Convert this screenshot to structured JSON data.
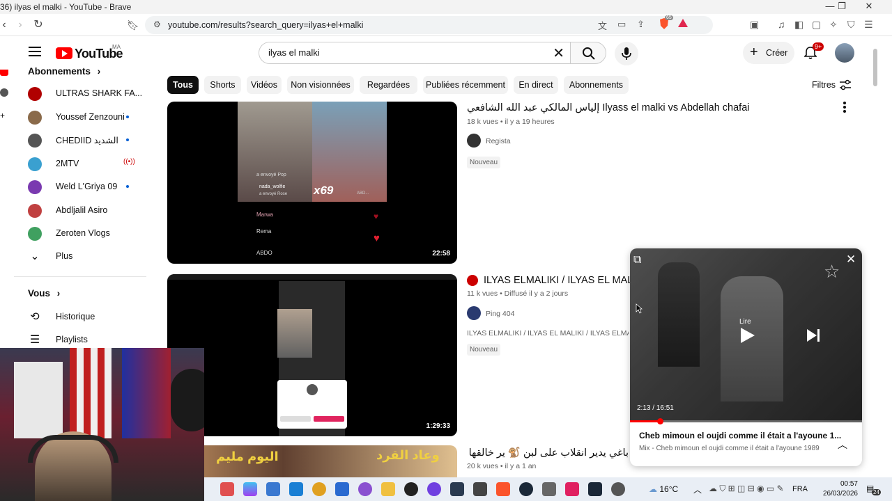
{
  "browser": {
    "window_title": "36) ilyas el malki - YouTube - Brave",
    "url": "youtube.com/results?search_query=ilyas+el+malki",
    "brave_badge": "65"
  },
  "header": {
    "logo_text": "YouTube",
    "country_code": "MA",
    "search_query": "ilyas el malki",
    "create_label": "Créer",
    "notif_badge": "9+"
  },
  "sidebar": {
    "subs_heading": "Abonnements",
    "subs_chevron": "›",
    "subscriptions": [
      {
        "name": "ULTRAS SHARK FA...",
        "color": "#b00000",
        "indicator": ""
      },
      {
        "name": "Youssef Zenzouni",
        "color": "#8a6a4a",
        "indicator": "dot"
      },
      {
        "name": "CHEDIID الشديد",
        "color": "#555555",
        "indicator": "dot"
      },
      {
        "name": "2MTV",
        "color": "#3aa0d0",
        "indicator": "live"
      },
      {
        "name": "Weld L'Griya 09",
        "color": "#7a3ab0",
        "indicator": "dot"
      },
      {
        "name": "Abdljalil Asiro",
        "color": "#c04040",
        "indicator": ""
      },
      {
        "name": "Zeroten Vlogs",
        "color": "#40a060",
        "indicator": ""
      }
    ],
    "more_label": "Plus",
    "you_heading": "Vous",
    "you_items": [
      {
        "label": "Historique"
      },
      {
        "label": "Playlists"
      }
    ]
  },
  "chips": [
    "Tous",
    "Shorts",
    "Vidéos",
    "Non visionnées",
    "Regardées",
    "Publiées récemment",
    "En direct",
    "Abonnements"
  ],
  "filters_label": "Filtres",
  "results": [
    {
      "title": "إلياس المالكي عبد الله الشافعي Ilyass el malki vs Abdellah chafai",
      "meta": "18 k vues • il y a 19 heures",
      "channel": "Regista",
      "badge": "Nouveau",
      "duration": "22:58",
      "thumb_texts": {
        "gift1": "a envoyé Pop",
        "user": "nada_wolfie",
        "gift2": "a envoyé Rose",
        "combo": "x69",
        "chat1": "Marwa",
        "chat2": "Rema",
        "chat3": "ABDO",
        "small": "ABD..."
      }
    },
    {
      "title": "ILYAS ELMALIKI / ILYAS EL MALIKI / ILYAS EL MAL",
      "meta": "11 k vues • Diffusé il y a 2 jours",
      "channel": "Ping 404",
      "description": "ILYAS ELMALIKI / ILYAS EL MALIKI / ILYAS ELMALIKI",
      "badge": "Nouveau",
      "duration": "1:29:33"
    },
    {
      "title": "باغي يدير انقلاب على لبن 🐒 ير خالقها مع القرد",
      "meta": "20 k vues • il y a 1 an",
      "thumb_texts": {
        "a": "اليوم مليم",
        "b": "وعاد القرد"
      }
    }
  ],
  "miniplayer": {
    "time": "2:13 / 16:51",
    "progress": 0.13,
    "play_label": "Lire",
    "title": "Cheb mimoun el oujdi comme il était a l'ayoune 1...",
    "subtitle": "Mix - Cheb mimoun el oujdi comme il était a l'ayoune 1989"
  },
  "taskbar": {
    "weather": "16°C",
    "lang": "FRA",
    "time": "00:57",
    "date": "26/03/2026",
    "notif_count": "24"
  }
}
